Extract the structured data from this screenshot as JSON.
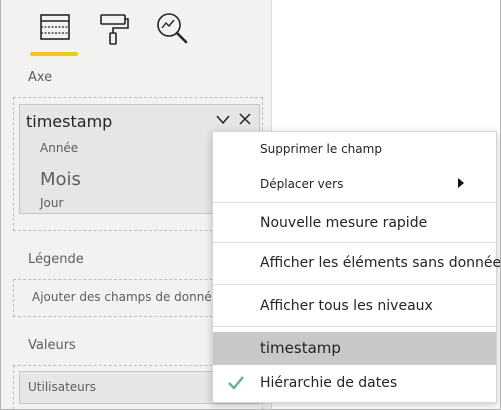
{
  "pane": {
    "tabs": [
      {
        "icon": "fields-icon",
        "active": true
      },
      {
        "icon": "format-paint-roller-icon",
        "active": false
      },
      {
        "icon": "analytics-magnifier-icon",
        "active": false
      }
    ],
    "accent_color": "#f2c811",
    "axis": {
      "label": "Axe",
      "field": {
        "name": "timestamp",
        "hierarchy": [
          "Année",
          "Mois",
          "Jour"
        ]
      }
    },
    "legend": {
      "label": "Légende",
      "placeholder": "Ajouter des champs de données ici"
    },
    "values": {
      "label": "Valeurs",
      "field": "Utilisateurs"
    }
  },
  "context_menu": {
    "items": [
      {
        "label": "Supprimer le champ"
      },
      {
        "label": "Déplacer vers",
        "has_submenu": true
      },
      {
        "label": "Nouvelle mesure rapide"
      },
      {
        "label": "Afficher les éléments sans données"
      },
      {
        "label": "Afficher tous les niveaux"
      },
      {
        "label": "timestamp",
        "selected": true
      },
      {
        "label": "Hiérarchie de dates",
        "checked": true
      }
    ],
    "check_color": "#6bae8e"
  }
}
